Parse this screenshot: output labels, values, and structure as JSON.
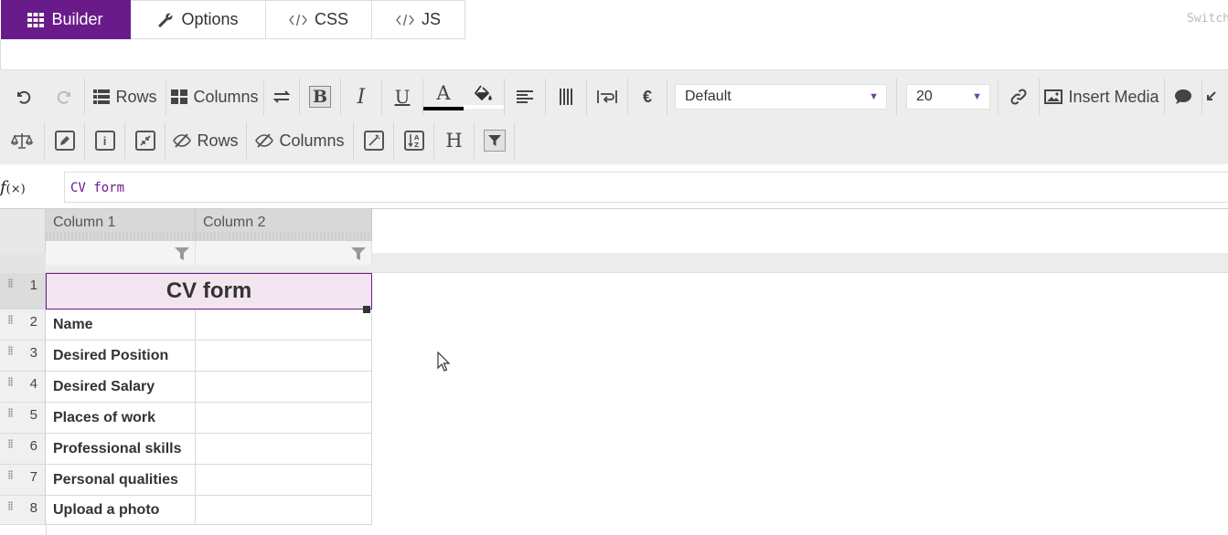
{
  "tabs": [
    {
      "label": "Builder",
      "icon": "grid-icon"
    },
    {
      "label": "Options",
      "icon": "wrench-icon"
    },
    {
      "label": "CSS",
      "icon": "code-icon"
    },
    {
      "label": "JS",
      "icon": "code-icon"
    }
  ],
  "switch_label": "Switch",
  "toolbar": {
    "rows_label": "Rows",
    "columns_label": "Columns",
    "font_select": "Default",
    "size_select": "20",
    "insert_media_label": "Insert Media",
    "hide_rows_label": "Rows",
    "hide_columns_label": "Columns",
    "bold_glyph": "B",
    "italic_glyph": "I",
    "underline_glyph": "U",
    "font_color_glyph": "A",
    "currency_glyph": "€",
    "header_glyph": "H",
    "info_glyph": "i",
    "font_color": "#000000",
    "fill_color": "#ffffff"
  },
  "formula": {
    "fx_label": "f",
    "fx_suffix": "(×)",
    "value": "CV form"
  },
  "grid": {
    "columns": [
      "Column 1",
      "Column 2"
    ],
    "title": "CV form",
    "row_numbers": [
      "1",
      "2",
      "3",
      "4",
      "5",
      "6",
      "7",
      "8"
    ],
    "rows": [
      "Name",
      "Desired Position",
      "Desired Salary",
      "Places of work",
      "Professional skills",
      "Personal qualities",
      "Upload a photo"
    ]
  },
  "colors": {
    "accent": "#6a1b8a",
    "selected_fill": "#f3e5f0"
  }
}
